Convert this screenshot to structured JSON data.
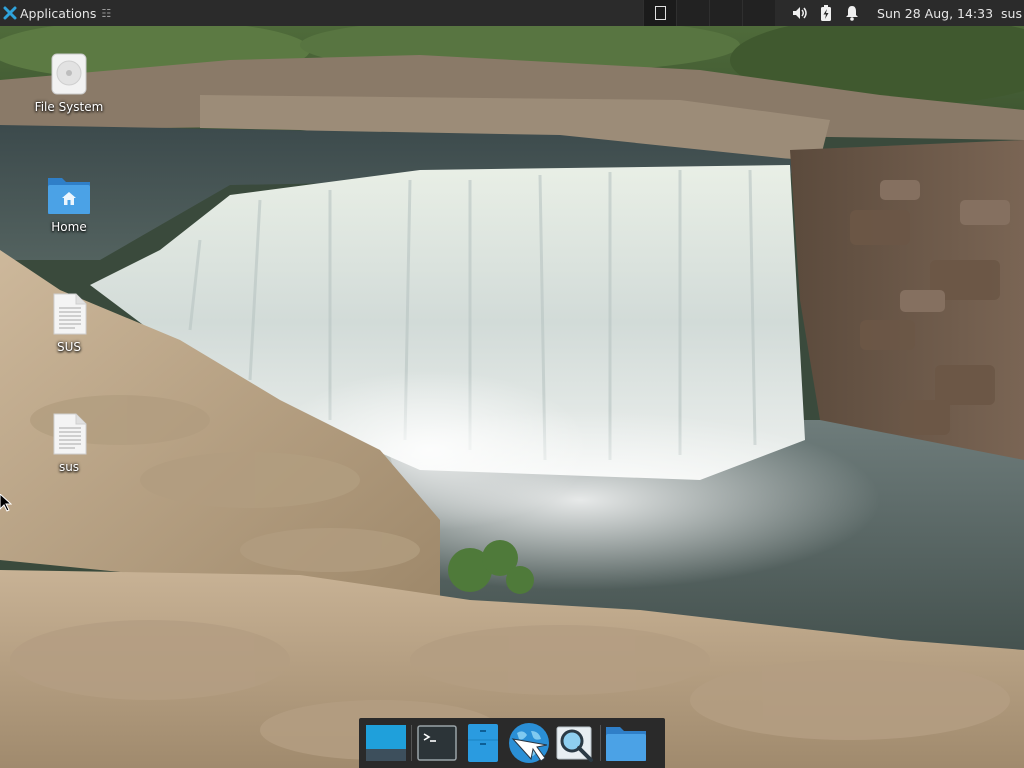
{
  "top_panel": {
    "applications_label": "Applications",
    "menu_arrow": "☷",
    "clock": "Sun 28 Aug, 14:33",
    "user": "sus",
    "workspaces": [
      {
        "name": "workspace-1",
        "active": true
      },
      {
        "name": "workspace-2",
        "active": false
      },
      {
        "name": "workspace-3",
        "active": false
      },
      {
        "name": "workspace-4",
        "active": false
      }
    ],
    "tray_icons": [
      "volume-icon",
      "battery-icon",
      "notification-bell-icon"
    ]
  },
  "desktop": {
    "icons": [
      {
        "label": "File System",
        "icon": "drive-icon"
      },
      {
        "label": "Home",
        "icon": "home-folder-icon"
      },
      {
        "label": "SUS",
        "icon": "text-file-icon"
      },
      {
        "label": "sus",
        "icon": "text-file-icon"
      }
    ]
  },
  "dock": {
    "items": [
      {
        "name": "show-desktop",
        "icon": "show-desktop-icon"
      },
      {
        "name": "terminal",
        "icon": "terminal-icon"
      },
      {
        "name": "file-manager",
        "icon": "file-manager-icon"
      },
      {
        "name": "web-browser",
        "icon": "web-browser-icon"
      },
      {
        "name": "app-finder",
        "icon": "app-finder-icon"
      },
      {
        "name": "folder",
        "icon": "folder-icon"
      }
    ]
  },
  "colors": {
    "panel_bg": "#2b2b2b",
    "dock_bg": "#2a2a2a",
    "accent_blue": "#2fa3dc"
  }
}
